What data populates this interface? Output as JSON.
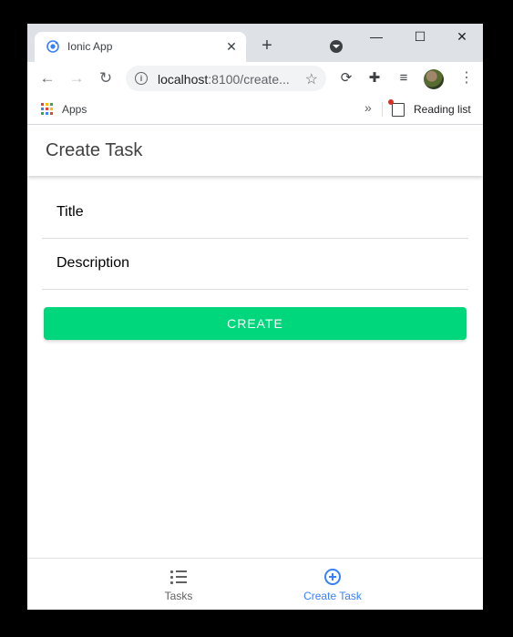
{
  "browser": {
    "tab_title": "Ionic App",
    "url_host": "localhost",
    "url_rest": ":8100/create...",
    "bookmarks": {
      "apps_label": "Apps",
      "reading_list_label": "Reading list"
    }
  },
  "page": {
    "header_title": "Create Task",
    "form": {
      "title_placeholder": "Title",
      "description_placeholder": "Description",
      "submit_label": "CREATE"
    }
  },
  "tabbar": {
    "tabs": [
      {
        "label": "Tasks",
        "icon": "list-icon",
        "selected": false
      },
      {
        "label": "Create Task",
        "icon": "add-circle-icon",
        "selected": true
      }
    ]
  },
  "colors": {
    "accent": "#3880ff",
    "success_button": "#00d67b",
    "header_text": "#424242"
  }
}
